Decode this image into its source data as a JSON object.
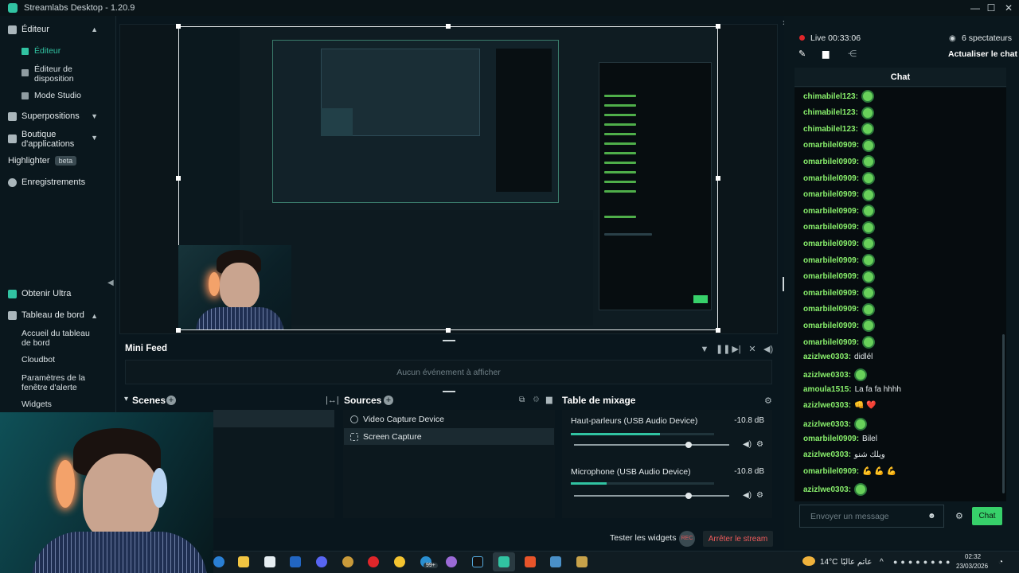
{
  "window": {
    "title": "Streamlabs Desktop - 1.20.9"
  },
  "sidebar": {
    "editor_label": "Éditeur",
    "editor_sub": [
      "Éditeur",
      "Éditeur de disposition",
      "Mode Studio"
    ],
    "overlays_label": "Superpositions",
    "appstore_label": "Boutique d'applications",
    "highlighter_label": "Highlighter",
    "highlighter_badge": "beta",
    "recordings_label": "Enregistrements",
    "ultra_label": "Obtenir Ultra",
    "dashboard_label": "Tableau de bord",
    "dashboard_sub": [
      "Accueil du tableau de bord",
      "Cloudbot",
      "Paramètres de la fenêtre d'alerte",
      "Widgets"
    ]
  },
  "minifeed": {
    "title": "Mini Feed",
    "empty": "Aucun événement à afficher"
  },
  "scenes": {
    "title": "Scenes"
  },
  "sources": {
    "title": "Sources",
    "items": [
      {
        "label": "Video Capture Device",
        "icon": "camera-icon"
      },
      {
        "label": "Screen Capture",
        "icon": "screen-capture-icon"
      }
    ]
  },
  "mixer": {
    "title": "Table de mixage",
    "channels": [
      {
        "name": "Haut-parleurs (USB Audio Device)",
        "db": "-10.8 dB",
        "level": 0.62,
        "volume": 0.72
      },
      {
        "name": "Microphone (USB Audio Device)",
        "db": "-10.8 dB",
        "level": 0.25,
        "volume": 0.72
      }
    ]
  },
  "bottom": {
    "test_widgets": "Tester les widgets",
    "stop_stream": "Arrêter le stream",
    "rec_label": "REC"
  },
  "chat": {
    "live_label": "Live 00:33:06",
    "viewers": "6 spectateurs",
    "refresh": "Actualiser le chat",
    "title": "Chat",
    "placeholder": "Envoyer un message",
    "send": "Chat",
    "messages": [
      {
        "user": "chimabilel123:",
        "text": ""
      },
      {
        "user": "chimabilel123:",
        "text": ""
      },
      {
        "user": "chimabilel123:",
        "text": ""
      },
      {
        "user": "omarbilel0909:",
        "text": ""
      },
      {
        "user": "omarbilel0909:",
        "text": ""
      },
      {
        "user": "omarbilel0909:",
        "text": ""
      },
      {
        "user": "omarbilel0909:",
        "text": ""
      },
      {
        "user": "omarbilel0909:",
        "text": ""
      },
      {
        "user": "omarbilel0909:",
        "text": ""
      },
      {
        "user": "omarbilel0909:",
        "text": ""
      },
      {
        "user": "omarbilel0909:",
        "text": ""
      },
      {
        "user": "omarbilel0909:",
        "text": ""
      },
      {
        "user": "omarbilel0909:",
        "text": ""
      },
      {
        "user": "omarbilel0909:",
        "text": ""
      },
      {
        "user": "omarbilel0909:",
        "text": ""
      },
      {
        "user": "omarbilel0909:",
        "text": ""
      },
      {
        "user": "azizlwe0303:",
        "text": "didlél"
      },
      {
        "user": "azizlwe0303:",
        "text": ""
      },
      {
        "user": "amoula1515:",
        "text": "La fa fa hhhh"
      },
      {
        "user": "azizlwe0303:",
        "text": "👊 ❤️"
      },
      {
        "user": "azizlwe0303:",
        "text": ""
      },
      {
        "user": "omarbilel0909:",
        "text": "Bilel"
      },
      {
        "user": "azizlwe0303:",
        "text": "ويلك شنو"
      },
      {
        "user": "omarbilel0909:",
        "text": "💪 💪 💪"
      },
      {
        "user": "azizlwe0303:",
        "text": ""
      }
    ]
  },
  "taskbar": {
    "weather": "14°C",
    "weather_text": "عاتم عالبًا",
    "time": "02:32",
    "date": "23/03/2026",
    "badge": "99+"
  }
}
